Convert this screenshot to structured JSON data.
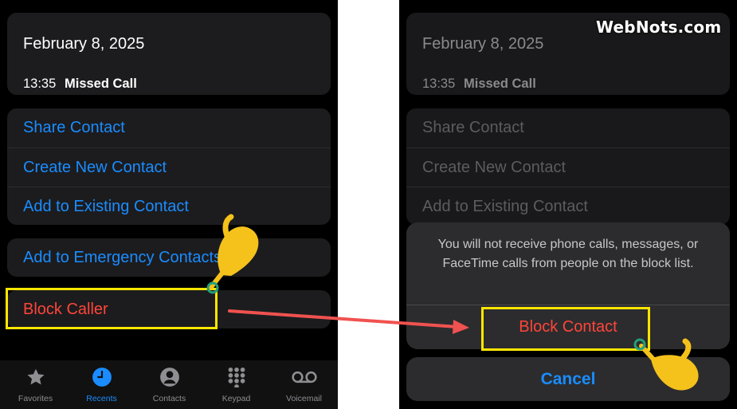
{
  "watermark": "WebNots.com",
  "call_info": {
    "date": "February 8, 2025",
    "time": "13:35",
    "type": "Missed Call"
  },
  "actions": {
    "share_contact": "Share Contact",
    "create_new_contact": "Create New Contact",
    "add_to_existing_contact": "Add to Existing Contact",
    "add_to_emergency_contacts": "Add to Emergency Contacts",
    "block_caller": "Block Caller"
  },
  "tabbar": {
    "favorites": "Favorites",
    "recents": "Recents",
    "contacts": "Contacts",
    "keypad": "Keypad",
    "voicemail": "Voicemail",
    "active_tab": "Recents"
  },
  "block_sheet": {
    "message": "You will not receive phone calls, messages, or FaceTime calls from people on the block list.",
    "block_contact": "Block Contact",
    "cancel": "Cancel"
  },
  "colors": {
    "accent_blue": "#1a8cff",
    "destructive_red": "#ff453a",
    "highlight_yellow": "#ffe600",
    "arrow_red": "#f0524f",
    "pointer_yellow": "#f5c21b"
  }
}
